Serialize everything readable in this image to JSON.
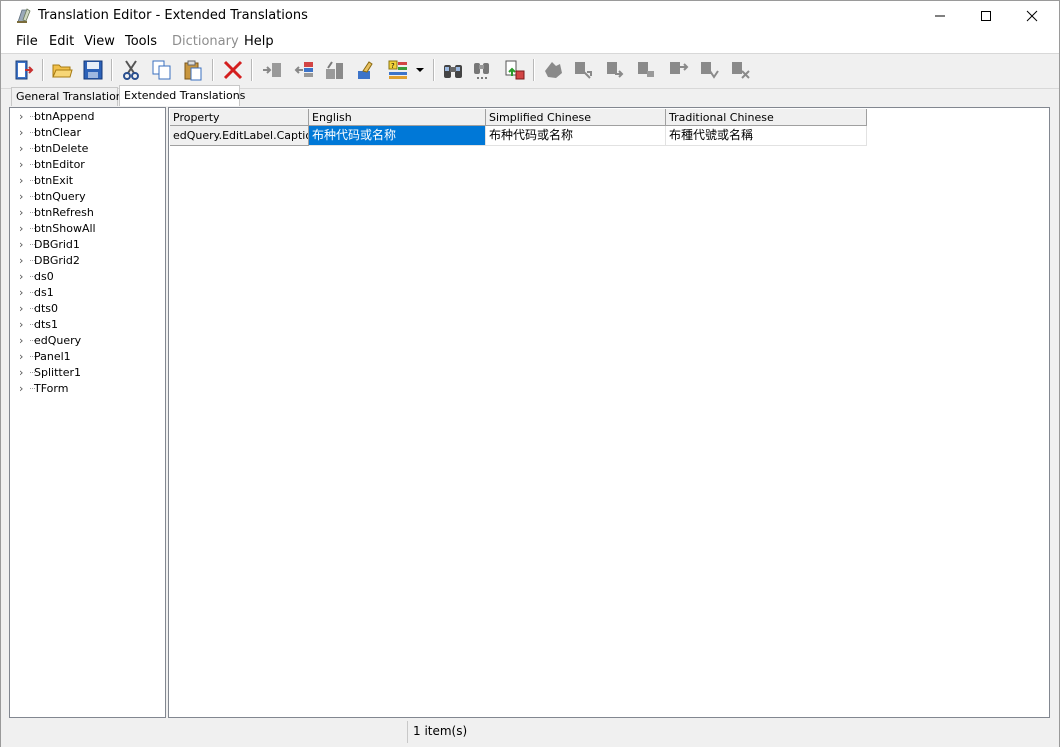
{
  "window": {
    "title": "Translation Editor - Extended Translations",
    "app_icon": "translation-app-icon",
    "controls": [
      "minimize-icon",
      "maximize-icon",
      "close-icon"
    ]
  },
  "menubar": {
    "items": [
      {
        "label": "File",
        "enabled": true
      },
      {
        "label": "Edit",
        "enabled": true
      },
      {
        "label": "View",
        "enabled": true
      },
      {
        "label": "Tools",
        "enabled": true
      },
      {
        "label": "Dictionary",
        "enabled": false
      },
      {
        "label": "Help",
        "enabled": true
      }
    ]
  },
  "toolbar": {
    "buttons": [
      "exit-icon",
      "open-folder-icon",
      "save-icon",
      "cut-icon",
      "copy-icon",
      "paste-icon",
      "delete-icon",
      "import-icon",
      "export-icon",
      "translate-icon",
      "clear-icon",
      "highlight-icon",
      "dropdown-arrow-icon",
      "find-icon",
      "find-next-icon",
      "update-icon",
      "tool-a-icon",
      "tool-b-icon",
      "tool-c-icon",
      "tool-d-icon",
      "tool-e-icon",
      "tool-f-icon",
      "tool-g-icon"
    ]
  },
  "tabs": [
    {
      "label": "General Translations",
      "active": false
    },
    {
      "label": "Extended Translations",
      "active": true
    }
  ],
  "tree": {
    "items": [
      "btnAppend",
      "btnClear",
      "btnDelete",
      "btnEditor",
      "btnExit",
      "btnQuery",
      "btnRefresh",
      "btnShowAll",
      "DBGrid1",
      "DBGrid2",
      "ds0",
      "ds1",
      "dts0",
      "dts1",
      "edQuery",
      "Panel1",
      "Splitter1",
      "TForm"
    ]
  },
  "grid": {
    "columns": [
      "Property",
      "English",
      "Simplified Chinese",
      "Traditional Chinese"
    ],
    "rows": [
      [
        "edQuery.EditLabel.Caption",
        "布种代码或名称",
        "布种代码或名称",
        "布種代號或名稱"
      ]
    ],
    "selected_color": "#0078d7"
  },
  "status": {
    "text": "1 item(s)"
  }
}
